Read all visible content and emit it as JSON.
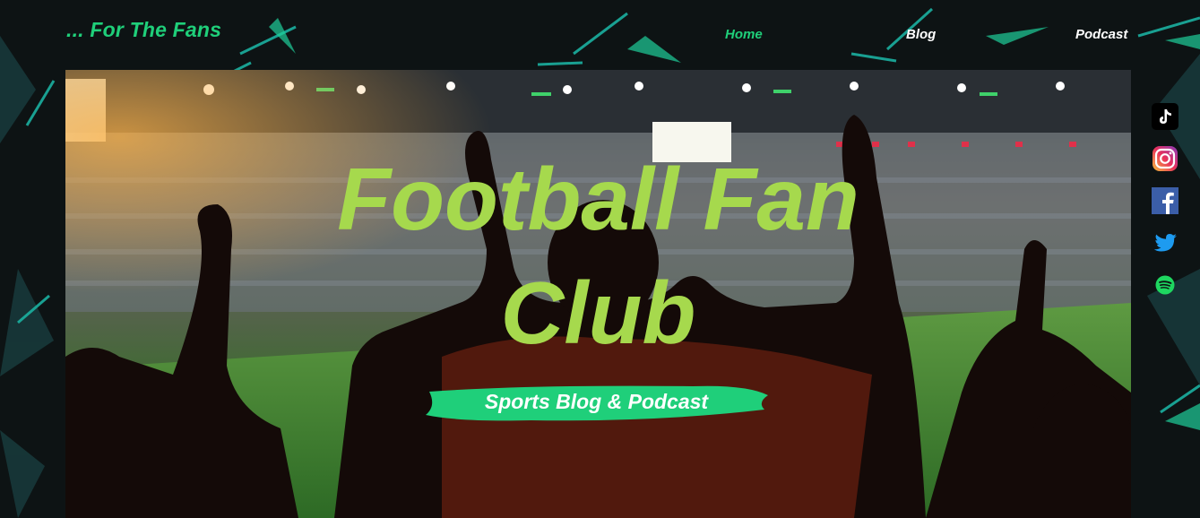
{
  "site": {
    "logo_text": "... For The Fans"
  },
  "nav": {
    "home": "Home",
    "blog": "Blog",
    "podcast": "Podcast"
  },
  "hero": {
    "title_line1": "Football Fan",
    "title_line2": "Club",
    "tagline": "Sports Blog & Podcast"
  },
  "social": [
    "tiktok-icon",
    "instagram-icon",
    "facebook-icon",
    "twitter-icon",
    "spotify-icon"
  ],
  "colors": {
    "accent_green": "#1fcf7a",
    "title_green": "#a6d94d",
    "background": "#0d1314",
    "teal_pattern": "#1bb0a0"
  }
}
